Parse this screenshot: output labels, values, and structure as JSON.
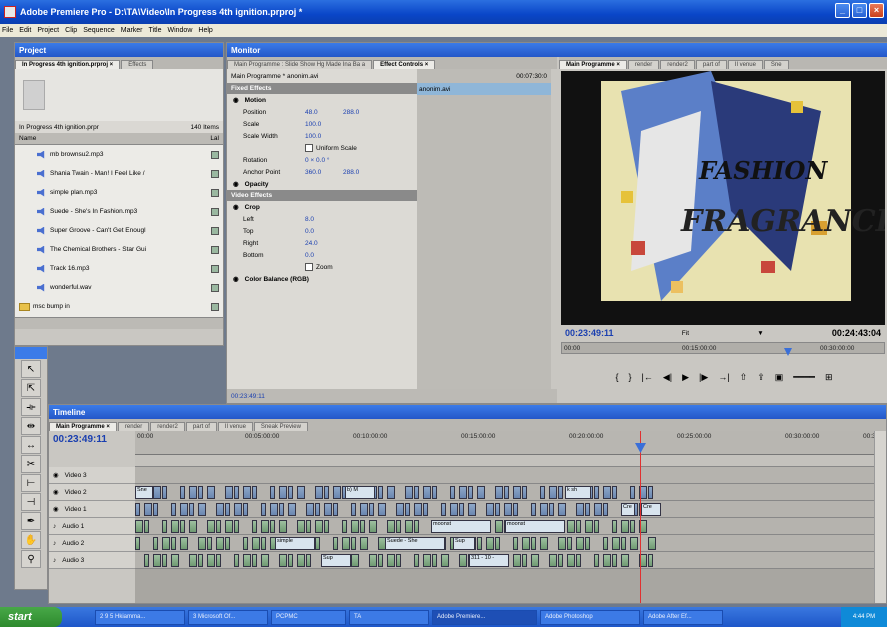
{
  "window": {
    "title": "Adobe Premiere Pro - D:\\TA\\Video\\In Progress 4th ignition.prproj *"
  },
  "menu": [
    "File",
    "Edit",
    "Project",
    "Clip",
    "Sequence",
    "Marker",
    "Title",
    "Window",
    "Help"
  ],
  "project": {
    "panel_title": "Project",
    "tabs": [
      "In Progress 4th ignition.prproj ×",
      "Effects"
    ],
    "bin_name": "In Progress 4th ignition.prpr",
    "item_count": "140 Items",
    "col_name": "Name",
    "col_label": "Lal",
    "items": [
      {
        "name": "mb brownsu2.mp3",
        "type": "audio"
      },
      {
        "name": "Shania Twain - Man! I Feel Like /",
        "type": "audio"
      },
      {
        "name": "simple plan.mp3",
        "type": "audio"
      },
      {
        "name": "Suede - She's In Fashion.mp3",
        "type": "audio"
      },
      {
        "name": "Super Groove - Can't Get Enougl",
        "type": "audio"
      },
      {
        "name": "The Chemical Brothers - Star Gui",
        "type": "audio"
      },
      {
        "name": "Track 16.mp3",
        "type": "audio"
      },
      {
        "name": "wonderful.wav",
        "type": "audio"
      },
      {
        "name": "msc bump in",
        "type": "folder"
      }
    ]
  },
  "monitor": {
    "panel_title": "Monitor",
    "source_tabs": [
      "Main Programme : Slide Show Hg Made Ina Ba a",
      "Effect Controls ×"
    ],
    "clip_label": "Main Programme * anonim.avi",
    "timecode_small": "00:07:30:0",
    "clip_name": "anonim.avi",
    "fixed_effects": "Fixed Effects",
    "motion": "Motion",
    "position_label": "Position",
    "position_x": "48.0",
    "position_y": "288.0",
    "scale_label": "Scale",
    "scale_value": "100.0",
    "scale_width_label": "Scale Width",
    "scale_width_value": "100.0",
    "uniform_scale": "Uniform Scale",
    "rotation_label": "Rotation",
    "rotation_value": "0 × 0.0 °",
    "anchor_label": "Anchor Point",
    "anchor_x": "360.0",
    "anchor_y": "288.0",
    "opacity": "Opacity",
    "video_effects": "Video Effects",
    "crop": "Crop",
    "left_label": "Left",
    "left_value": "8.0",
    "top_label": "Top",
    "top_value": "0.0",
    "right_label": "Right",
    "right_value": "24.0",
    "bottom_label": "Bottom",
    "bottom_value": "0.0",
    "zoom": "Zoom",
    "color_balance": "Color Balance (RGB)",
    "ec_timecode": "00:23:49:11",
    "program_tabs": [
      "Main Programme ×",
      "render",
      "render2",
      "part of",
      "Il venue",
      "Sne"
    ],
    "program_timecode": "00:23:49:11",
    "fit": "Fit",
    "duration": "00:24:43:04",
    "mini_ruler_start": "00:00",
    "mini_ruler_mid": "00:15:00:00",
    "mini_ruler_end": "00:30:00:00",
    "video_text_1": "FASHION",
    "video_text_2": "FRAGRANCE"
  },
  "timeline": {
    "panel_title": "Timeline",
    "tabs": [
      "Main Programme ×",
      "render",
      "render2",
      "part of",
      "Il venue",
      "Sneak Preview"
    ],
    "timecode": "00:23:49:11",
    "ruler": [
      "00:00",
      "00:05:00:00",
      "00:10:00:00",
      "00:15:00:00",
      "00:20:00:00",
      "00:25:00:00",
      "00:30:00:00",
      "00:3"
    ],
    "tracks": [
      {
        "name": "Video 3",
        "kind": "video"
      },
      {
        "name": "Video 2",
        "kind": "video"
      },
      {
        "name": "Video 1",
        "kind": "video"
      },
      {
        "name": "Audio 1",
        "kind": "audio"
      },
      {
        "name": "Audio 2",
        "kind": "audio"
      },
      {
        "name": "Audio 3",
        "kind": "audio"
      }
    ],
    "clip_labels": {
      "v1_a": "Sne",
      "v1_b": "b) M",
      "v1_c": "k sh",
      "v1_d": "Cre",
      "v1_e": "Cre",
      "a1_a": "moonst",
      "a1_b": "moonst",
      "a2_a": "simple",
      "a2_b": "Suede - She",
      "a2_c": "Sup",
      "a3_a": "Sup",
      "a3_b": "311 - 10 -"
    }
  },
  "taskbar": {
    "start": "start",
    "tasks": [
      "2 9 5 Hkiamma...",
      "3 Microsoft Of...",
      "PCPMC",
      "TA",
      "Adobe Premiere...",
      "Adobe Photoshop",
      "Adobe After Ef..."
    ],
    "clock": "4:44 PM"
  },
  "colors": {
    "title_blue": "#0a46c8",
    "panel_gray": "#c9c7c2",
    "playhead": "#e03030"
  }
}
